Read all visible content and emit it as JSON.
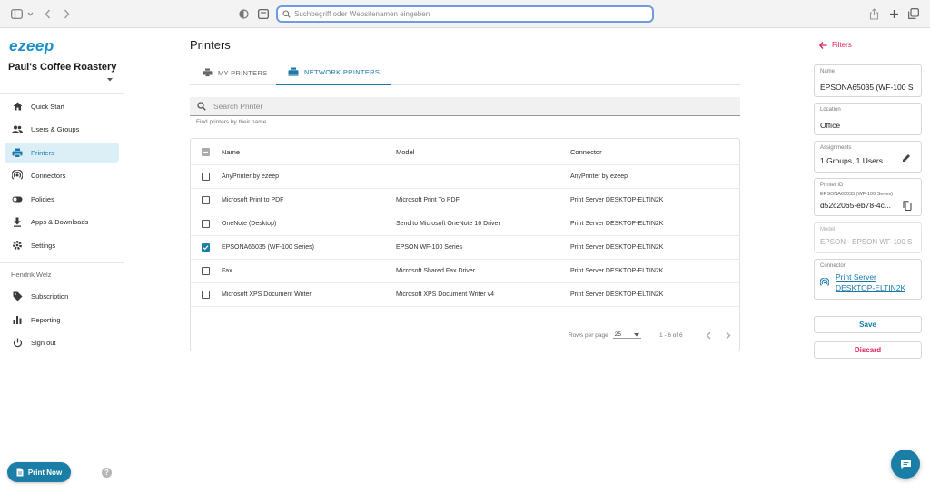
{
  "browser": {
    "address_placeholder": "Suchbegriff oder Websitenamen eingeben"
  },
  "sidebar": {
    "logo": "ezeep",
    "org_name": "Paul's Coffee Roastery",
    "items": [
      {
        "label": "Quick Start",
        "icon": "home-icon"
      },
      {
        "label": "Users & Groups",
        "icon": "people-icon"
      },
      {
        "label": "Printers",
        "icon": "printer-icon"
      },
      {
        "label": "Connectors",
        "icon": "connector-icon"
      },
      {
        "label": "Policies",
        "icon": "toggle-icon"
      },
      {
        "label": "Apps & Downloads",
        "icon": "download-icon"
      },
      {
        "label": "Settings",
        "icon": "gear-icon"
      }
    ],
    "user_name": "Hendrik Welz",
    "user_items": [
      {
        "label": "Subscription",
        "icon": "tag-icon"
      },
      {
        "label": "Reporting",
        "icon": "bar-chart-icon"
      },
      {
        "label": "Sign out",
        "icon": "power-icon"
      }
    ],
    "print_now": "Print Now",
    "help": "?"
  },
  "main": {
    "title": "Printers",
    "tabs": [
      {
        "label": "MY PRINTERS",
        "active": false
      },
      {
        "label": "NETWORK PRINTERS",
        "active": true
      }
    ],
    "search": {
      "placeholder": "Search Printer",
      "helper": "Find printers by their name"
    },
    "table": {
      "columns": [
        "Name",
        "Model",
        "Connector"
      ],
      "rows": [
        {
          "name": "AnyPrinter by ezeep",
          "model": "",
          "connector": "AnyPrinter by ezeep",
          "checked": false
        },
        {
          "name": "Microsoft Print to PDF",
          "model": "Microsoft Print To PDF",
          "connector": "Print Server DESKTOP-ELTIN2K",
          "checked": false
        },
        {
          "name": "OneNote (Desktop)",
          "model": "Send to Microsoft OneNote 16 Driver",
          "connector": "Print Server DESKTOP-ELTIN2K",
          "checked": false
        },
        {
          "name": "EPSONA65035 (WF-100 Series)",
          "model": "EPSON WF-100 Series",
          "connector": "Print Server DESKTOP-ELTIN2K",
          "checked": true
        },
        {
          "name": "Fax",
          "model": "Microsoft Shared Fax Driver",
          "connector": "Print Server DESKTOP-ELTIN2K",
          "checked": false
        },
        {
          "name": "Microsoft XPS Document Writer",
          "model": "Microsoft XPS Document Writer v4",
          "connector": "Print Server DESKTOP-ELTIN2K",
          "checked": false
        }
      ],
      "pagination": {
        "rows_per_page_label": "Rows per page",
        "rows_per_page": "25",
        "range": "1 - 6 of 6"
      }
    }
  },
  "panel": {
    "back_label": "Filters",
    "name": {
      "label": "Name",
      "value": "EPSONA65035 (WF-100 S"
    },
    "location": {
      "label": "Location",
      "value": "Office"
    },
    "assignments": {
      "label": "Assignments",
      "value": "1 Groups, 1 Users"
    },
    "printer_id": {
      "label": "Printer ID",
      "sub": "EPSONA65035 (WF-100 Series)",
      "value": "d52c2065-eb78-4c..."
    },
    "model": {
      "label": "Model",
      "value": "EPSON - EPSON WF-100 S"
    },
    "connector": {
      "label": "Connector",
      "line1": "Print Server",
      "line2": "DESKTOP-ELTIN2K"
    },
    "save": "Save",
    "discard": "Discard"
  },
  "colors": {
    "accent": "#1a7ea6",
    "active_bg": "#dceff7",
    "danger": "#e0245e"
  }
}
